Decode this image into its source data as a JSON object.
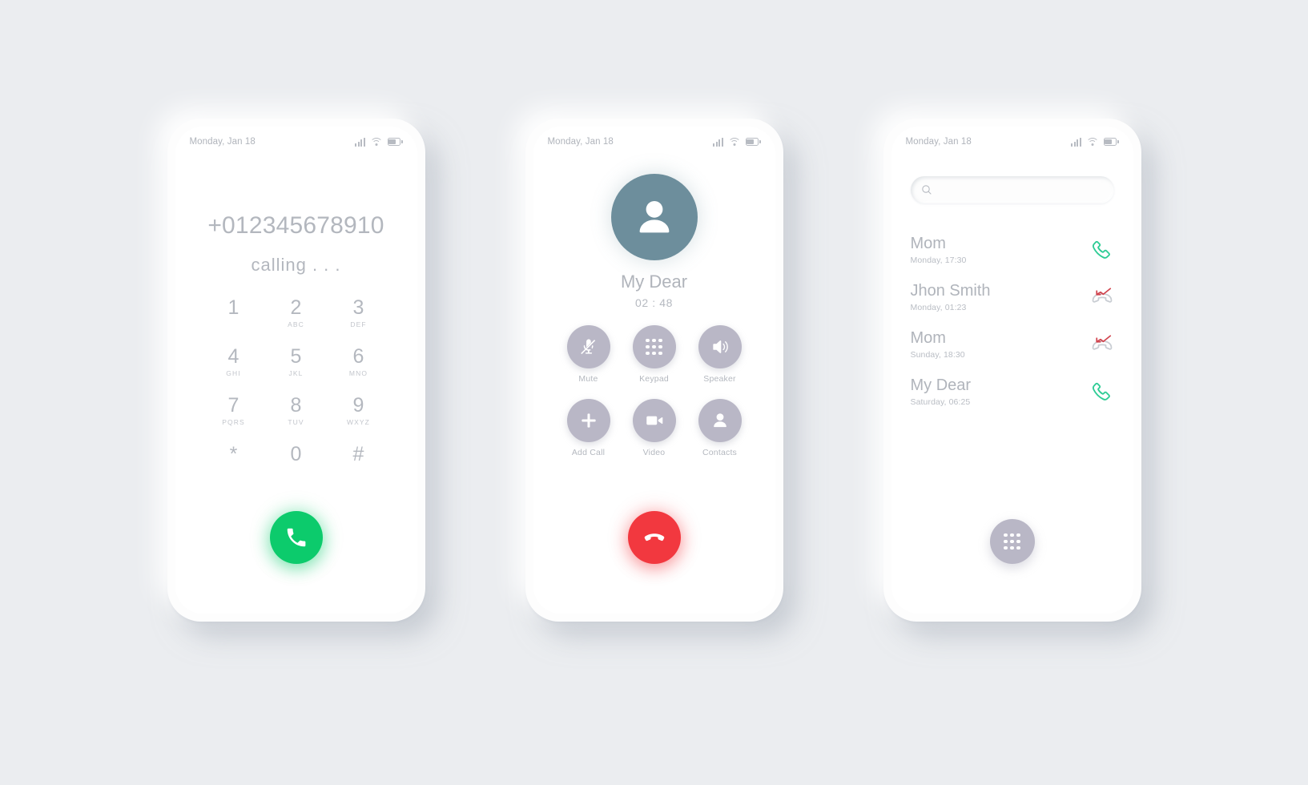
{
  "theme": {
    "background": "#ebedf0",
    "screen_bg": "#ffffff",
    "text_muted": "#b3b7be",
    "accent_green": "#0ccb6c",
    "accent_red": "#f2383f",
    "avatar_bg": "#6d8e9c",
    "bubble_gray": "#b9b7c6",
    "missed_red": "#d1454f",
    "answered_green": "#2ecc95"
  },
  "statusbar": {
    "date": "Monday, Jan 18",
    "icons": [
      "signal-icon",
      "wifi-icon",
      "battery-icon"
    ]
  },
  "screens": [
    {
      "id": "dialing",
      "number": "+012345678910",
      "status_text": "calling . . .",
      "keys": [
        {
          "digit": "1",
          "letters": ""
        },
        {
          "digit": "2",
          "letters": "ABC"
        },
        {
          "digit": "3",
          "letters": "DEF"
        },
        {
          "digit": "4",
          "letters": "GHI"
        },
        {
          "digit": "5",
          "letters": "JKL"
        },
        {
          "digit": "6",
          "letters": "MNO"
        },
        {
          "digit": "7",
          "letters": "PQRS"
        },
        {
          "digit": "8",
          "letters": "TUV"
        },
        {
          "digit": "9",
          "letters": "WXYZ"
        },
        {
          "digit": "*",
          "letters": ""
        },
        {
          "digit": "0",
          "letters": ""
        },
        {
          "digit": "#",
          "letters": ""
        }
      ],
      "call_button": {
        "icon": "phone-icon",
        "label": "Call"
      }
    },
    {
      "id": "in-call",
      "avatar_icon": "person-icon",
      "caller_name": "My Dear",
      "timer": "02 : 48",
      "actions": [
        {
          "label": "Mute",
          "icon": "microphone-off-icon"
        },
        {
          "label": "Keypad",
          "icon": "keypad-dots-icon"
        },
        {
          "label": "Speaker",
          "icon": "speaker-icon"
        },
        {
          "label": "Add Call",
          "icon": "plus-icon"
        },
        {
          "label": "Video",
          "icon": "video-camera-icon"
        },
        {
          "label": "Contacts",
          "icon": "person-icon"
        }
      ],
      "end_button": {
        "icon": "phone-hangup-icon",
        "label": "End Call"
      }
    },
    {
      "id": "recents",
      "search": {
        "value": "",
        "placeholder": "",
        "icon": "search-icon"
      },
      "calls": [
        {
          "name": "Mom",
          "time": "Monday, 17:30",
          "type": "answered",
          "icon": "phone-answered-icon"
        },
        {
          "name": "Jhon Smith",
          "time": "Monday, 01:23",
          "type": "missed",
          "icon": "phone-missed-icon"
        },
        {
          "name": "Mom",
          "time": "Sunday, 18:30",
          "type": "missed",
          "icon": "phone-missed-icon"
        },
        {
          "name": "My Dear",
          "time": "Saturday, 06:25",
          "type": "answered",
          "icon": "phone-answered-icon"
        }
      ],
      "keypad_button": {
        "icon": "keypad-dots-icon",
        "label": "Keypad"
      }
    }
  ]
}
